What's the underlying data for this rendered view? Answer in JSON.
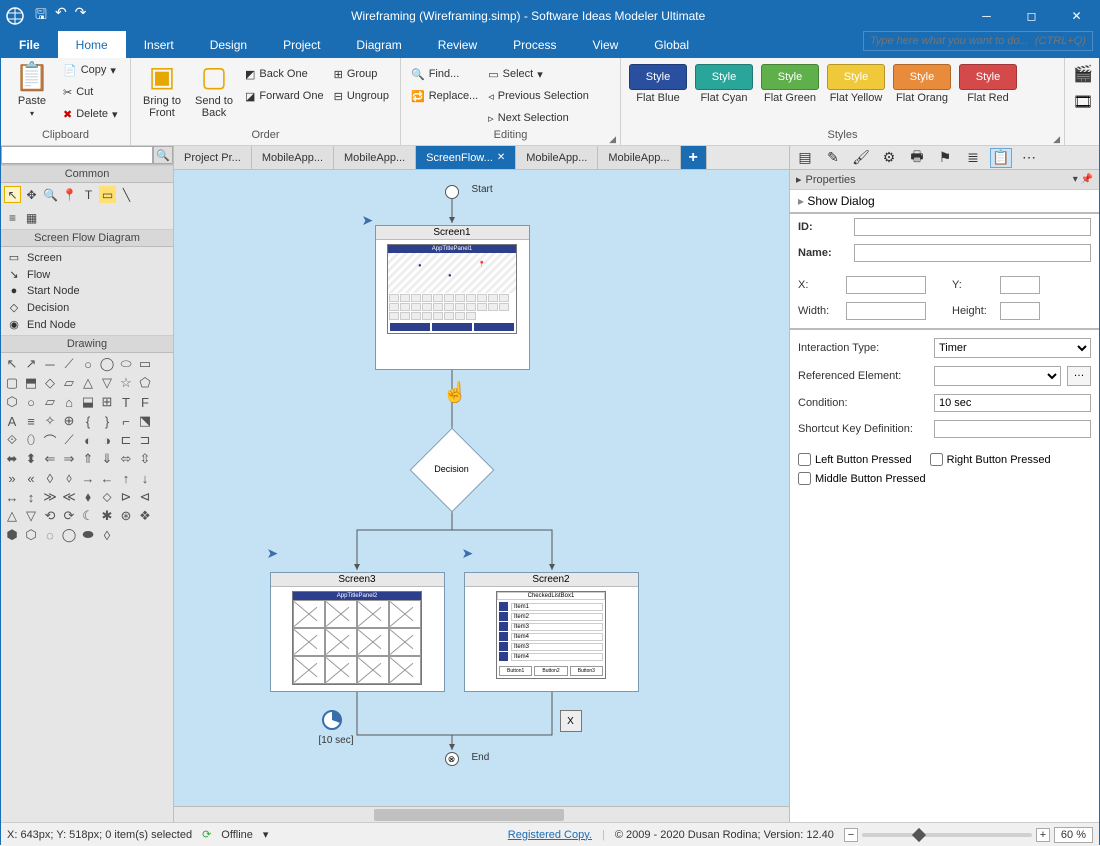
{
  "title": "Wireframing (Wireframing.simp) - Software Ideas Modeler Ultimate",
  "searchPlaceholder": "Type here what you want to do...  (CTRL+Q)",
  "menu": {
    "file": "File",
    "tabs": [
      "Home",
      "Insert",
      "Design",
      "Project",
      "Diagram",
      "Review",
      "Process",
      "View",
      "Global"
    ]
  },
  "ribbon": {
    "clipboard": {
      "paste": "Paste",
      "copy": "Copy",
      "cut": "Cut",
      "delete": "Delete",
      "label": "Clipboard"
    },
    "order": {
      "bringFront": "Bring to\nFront",
      "sendBack": "Send to\nBack",
      "backOne": "Back One",
      "forwardOne": "Forward One",
      "group": "Group",
      "ungroup": "Ungroup",
      "label": "Order"
    },
    "editing": {
      "find": "Find...",
      "replace": "Replace...",
      "select": "Select",
      "prevSel": "Previous Selection",
      "nextSel": "Next Selection",
      "label": "Editing"
    },
    "styles": {
      "label": "Styles",
      "items": [
        {
          "text": "Style",
          "name": "Flat Blue",
          "bg": "#2a4f9e"
        },
        {
          "text": "Style",
          "name": "Flat Cyan",
          "bg": "#29a59a"
        },
        {
          "text": "Style",
          "name": "Flat Green",
          "bg": "#5fb04b"
        },
        {
          "text": "Style",
          "name": "Flat Yellow",
          "bg": "#f0c93a"
        },
        {
          "text": "Style",
          "name": "Flat Orang",
          "bg": "#e88b3a"
        },
        {
          "text": "Style",
          "name": "Flat Red",
          "bg": "#d44a4a"
        }
      ]
    }
  },
  "leftPanels": {
    "common": "Common",
    "screenFlow": "Screen Flow Diagram",
    "drawing": "Drawing",
    "items": [
      {
        "icon": "▭",
        "label": "Screen"
      },
      {
        "icon": "↘",
        "label": "Flow"
      },
      {
        "icon": "●",
        "label": "Start Node"
      },
      {
        "icon": "◇",
        "label": "Decision"
      },
      {
        "icon": "◉",
        "label": "End Node"
      }
    ]
  },
  "docTabs": [
    "Project Pr...",
    "MobileApp...",
    "MobileApp...",
    "ScreenFlow...",
    "MobileApp...",
    "MobileApp..."
  ],
  "activeTab": 3,
  "diagram": {
    "start": "Start",
    "screen1": "Screen1",
    "decision": "Decision",
    "screen2": "Screen2",
    "screen3": "Screen3",
    "end": "End",
    "timer": "[10 sec]",
    "key": "X",
    "app1": "AppTitlePanel1",
    "app2": "AppTitlePanel2",
    "chkTitle": "CheckedListBox1",
    "chkItems": [
      "Item1",
      "Item2",
      "Item3",
      "Item4",
      "Item3",
      "Item4"
    ],
    "btns": [
      "Button1",
      "Button2",
      "Button3"
    ]
  },
  "properties": {
    "header": "Properties",
    "sub": "Show Dialog",
    "id": "ID:",
    "name": "Name:",
    "x": "X:",
    "y": "Y:",
    "width": "Width:",
    "height": "Height:",
    "interaction": "Interaction Type:",
    "interactionVal": "Timer",
    "refEl": "Referenced Element:",
    "condition": "Condition:",
    "conditionVal": "10 sec",
    "shortcut": "Shortcut Key Definition:",
    "leftBtn": "Left Button Pressed",
    "rightBtn": "Right Button Pressed",
    "midBtn": "Middle Button Pressed"
  },
  "status": {
    "coords": "X: 643px; Y: 518px; 0 item(s) selected",
    "offline": "Offline",
    "reg": "Registered Copy.",
    "copy": "© 2009 - 2020 Dusan Rodina; Version: 12.40",
    "zoom": "60 %"
  }
}
